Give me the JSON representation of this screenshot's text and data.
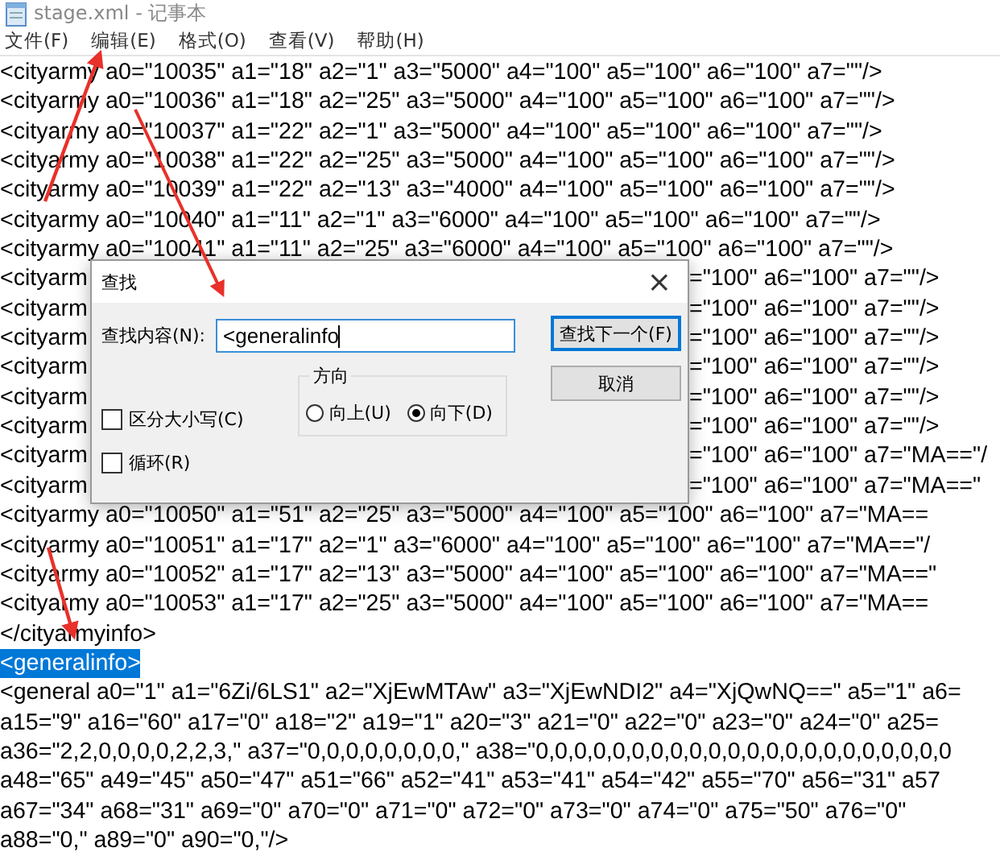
{
  "window": {
    "title": "stage.xml - 记事本"
  },
  "menu": [
    "文件(F)",
    "编辑(E)",
    "格式(O)",
    "查看(V)",
    "帮助(H)"
  ],
  "lines": [
    {
      "kind": "line",
      "text": "<cityarmy a0=\"10035\" a1=\"18\" a2=\"1\" a3=\"5000\" a4=\"100\" a5=\"100\" a6=\"100\" a7=\"\"/>",
      "selected": false
    },
    {
      "kind": "line",
      "text": "<cityarmy a0=\"10036\" a1=\"18\" a2=\"25\" a3=\"5000\" a4=\"100\" a5=\"100\" a6=\"100\" a7=\"\"/>",
      "selected": false
    },
    {
      "kind": "line",
      "text": "<cityarmy a0=\"10037\" a1=\"22\" a2=\"1\" a3=\"5000\" a4=\"100\" a5=\"100\" a6=\"100\" a7=\"\"/>",
      "selected": false
    },
    {
      "kind": "line",
      "text": "<cityarmy a0=\"10038\" a1=\"22\" a2=\"25\" a3=\"5000\" a4=\"100\" a5=\"100\" a6=\"100\" a7=\"\"/>",
      "selected": false
    },
    {
      "kind": "line",
      "text": "<cityarmy a0=\"10039\" a1=\"22\" a2=\"13\" a3=\"4000\" a4=\"100\" a5=\"100\" a6=\"100\" a7=\"\"/>",
      "selected": false
    },
    {
      "kind": "line",
      "text": "<cityarmy a0=\"10040\" a1=\"11\" a2=\"1\" a3=\"6000\" a4=\"100\" a5=\"100\" a6=\"100\" a7=\"\"/>",
      "selected": false
    },
    {
      "kind": "line",
      "text": "<cityarmy a0=\"10041\" a1=\"11\" a2=\"25\" a3=\"6000\" a4=\"100\" a5=\"100\" a6=\"100\" a7=\"\"/>",
      "selected": false
    },
    {
      "kind": "covered",
      "left": "<cityarm",
      "right": "=\"100\" a6=\"100\" a7=\"\"/>",
      "selected": false
    },
    {
      "kind": "covered",
      "left": "<cityarm",
      "right": "=\"100\" a6=\"100\" a7=\"\"/>",
      "selected": false
    },
    {
      "kind": "covered",
      "left": "<cityarm",
      "right": "=\"100\" a6=\"100\" a7=\"\"/>",
      "selected": false
    },
    {
      "kind": "covered",
      "left": "<cityarm",
      "right": "=\"100\" a6=\"100\" a7=\"\"/>",
      "selected": false
    },
    {
      "kind": "covered",
      "left": "<cityarm",
      "right": "=\"100\" a6=\"100\" a7=\"\"/>",
      "selected": false
    },
    {
      "kind": "covered",
      "left": "<cityarm",
      "right": "=\"100\" a6=\"100\" a7=\"\"/>",
      "selected": false
    },
    {
      "kind": "covered",
      "left": "<cityarm",
      "right": "=\"100\" a6=\"100\" a7=\"MA==\"/",
      "selected": false
    },
    {
      "kind": "covered",
      "left": "<cityarm",
      "right": "=\"100\" a6=\"100\" a7=\"MA==\"",
      "selected": false
    },
    {
      "kind": "line",
      "text": "<cityarmy a0=\"10050\" a1=\"51\" a2=\"25\" a3=\"5000\" a4=\"100\" a5=\"100\" a6=\"100\" a7=\"MA==",
      "selected": false
    },
    {
      "kind": "line",
      "text": "<cityarmy a0=\"10051\" a1=\"17\" a2=\"1\" a3=\"6000\" a4=\"100\" a5=\"100\" a6=\"100\" a7=\"MA==\"/",
      "selected": false
    },
    {
      "kind": "line",
      "text": "<cityarmy a0=\"10052\" a1=\"17\" a2=\"13\" a3=\"5000\" a4=\"100\" a5=\"100\" a6=\"100\" a7=\"MA==\"",
      "selected": false
    },
    {
      "kind": "line",
      "text": "<cityarmy a0=\"10053\" a1=\"17\" a2=\"25\" a3=\"5000\" a4=\"100\" a5=\"100\" a6=\"100\" a7=\"MA==",
      "selected": false
    },
    {
      "kind": "line",
      "text": "</cityarmyinfo>",
      "selected": false
    },
    {
      "kind": "line",
      "text": "<generalinfo>",
      "selected": true
    },
    {
      "kind": "line",
      "text": "<general a0=\"1\" a1=\"6Zi/6LS1\" a2=\"XjEwMTAw\" a3=\"XjEwNDI2\" a4=\"XjQwNQ==\" a5=\"1\" a6=",
      "selected": false
    },
    {
      "kind": "line",
      "text": "a15=\"9\" a16=\"60\" a17=\"0\" a18=\"2\" a19=\"1\" a20=\"3\" a21=\"0\" a22=\"0\" a23=\"0\" a24=\"0\" a25=",
      "selected": false
    },
    {
      "kind": "line",
      "text": "a36=\"2,2,0,0,0,0,2,2,3,\" a37=\"0,0,0,0,0,0,0,0,\" a38=\"0,0,0,0,0,0,0,0,0,0,0,0,0,0,0,0,0,0,0,0,0,0",
      "selected": false
    },
    {
      "kind": "line",
      "text": "a48=\"65\" a49=\"45\" a50=\"47\" a51=\"66\" a52=\"41\" a53=\"41\" a54=\"42\" a55=\"70\" a56=\"31\" a57",
      "selected": false
    },
    {
      "kind": "line",
      "text": "a67=\"34\" a68=\"31\" a69=\"0\" a70=\"0\" a71=\"0\" a72=\"0\" a73=\"0\" a74=\"0\" a75=\"50\" a76=\"0\"",
      "selected": false
    },
    {
      "kind": "line",
      "text": "a88=\"0,\" a89=\"0\" a90=\"0,\"/>",
      "selected": false
    }
  ],
  "find_dialog": {
    "title": "查找",
    "close": "×",
    "find_label": "查找内容(N):",
    "find_value": "<generalinfo",
    "buttons": [
      {
        "label": "查找下一个(F)",
        "default": true
      },
      {
        "label": "取消",
        "default": false
      }
    ],
    "direction": {
      "title": "方向",
      "options": [
        {
          "label": "向上(U)",
          "selected": false
        },
        {
          "label": "向下(D)",
          "selected": true
        }
      ]
    },
    "checkboxes": [
      {
        "label": "区分大小写(C)",
        "checked": false
      },
      {
        "label": "循环(R)",
        "checked": false
      }
    ]
  }
}
